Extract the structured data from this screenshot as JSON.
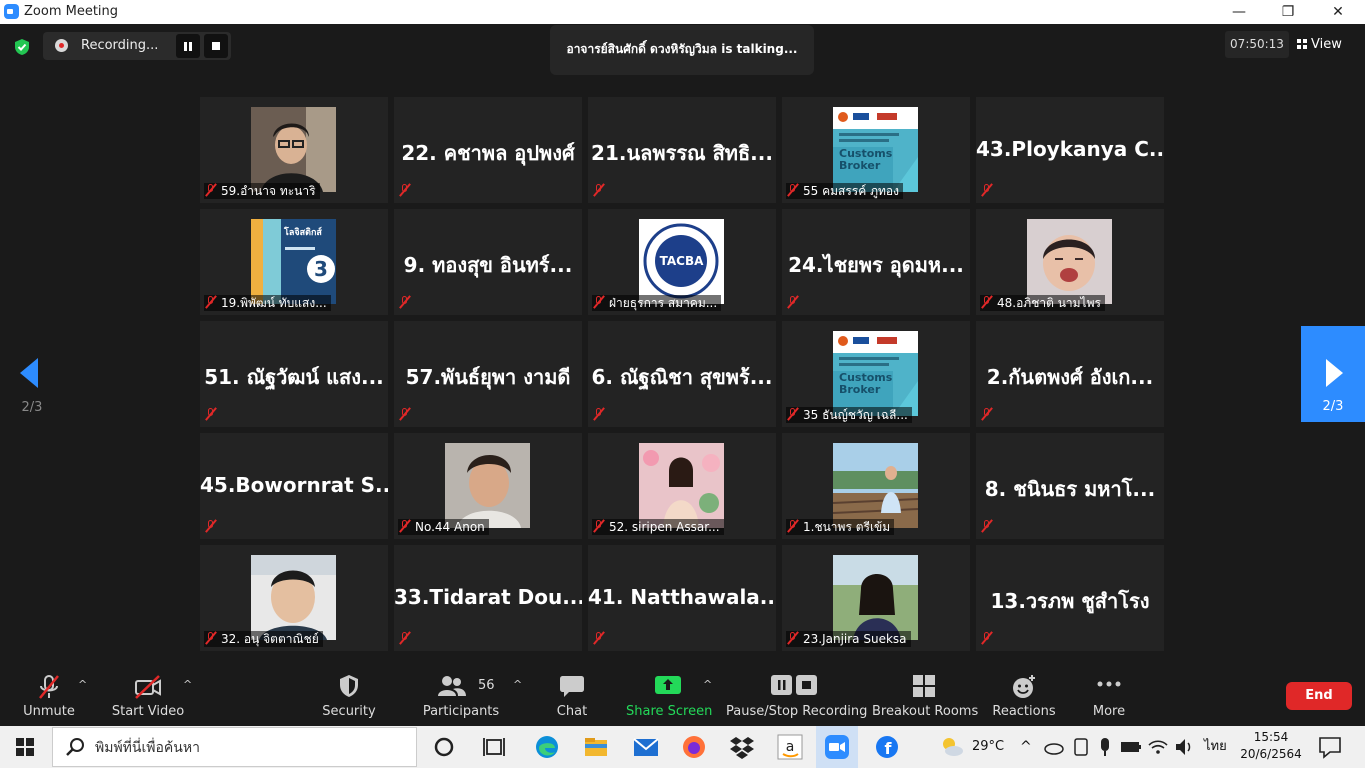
{
  "window": {
    "title": "Zoom Meeting",
    "minimize": "—",
    "restore": "❐",
    "close": "✕"
  },
  "recording": {
    "label": "Recording..."
  },
  "talking": {
    "text": "อาจารย์สินศักดิ์  ดวงหิรัญวิมล is talking..."
  },
  "meeting_timer": "07:50:13",
  "view_label": "View",
  "pager": {
    "left_page": "2/3",
    "right_page": "2/3"
  },
  "participants": [
    {
      "big": "",
      "label": "59.อำนาจ ทะนาริ",
      "photo": "man-glasses"
    },
    {
      "big": "22. คชาพล อุปพงศ์",
      "label": ""
    },
    {
      "big": "21.นลพรรณ สิทธิ...",
      "label": ""
    },
    {
      "big": "",
      "label": "55 คมสรรค์ ภูทอง",
      "photo": "customs-broker",
      "photo_text1": "Customs",
      "photo_text2": "Broker"
    },
    {
      "big": "43.Ploykanya  C...",
      "label": ""
    },
    {
      "big": "",
      "label": "19.พิพัฒน์ ทับแสง...",
      "photo": "logistics-book",
      "photo_text1": "โลจิสติกส์",
      "photo_text2": "3"
    },
    {
      "big": "9. ทองสุข อินทร์...",
      "label": ""
    },
    {
      "big": "",
      "label": "ฝ่ายธุรการ สมาคม...",
      "photo": "tacba-logo",
      "photo_text1": "TACBA"
    },
    {
      "big": "24.ไชยพร อุดมห...",
      "label": ""
    },
    {
      "big": "",
      "label": "48.อภิชาติ นามไพร",
      "photo": "baby"
    },
    {
      "big": "51. ณัฐวัฒน์ แสง...",
      "label": ""
    },
    {
      "big": "57.พันธ์ยุพา งามดี",
      "label": ""
    },
    {
      "big": "6. ณัฐณิชา สุขพร้...",
      "label": ""
    },
    {
      "big": "",
      "label": "35 ธันญ์ชวัญ เฉลี...",
      "photo": "customs-broker",
      "photo_text1": "Customs",
      "photo_text2": "Broker"
    },
    {
      "big": "2.กันตพงศ์ อังเก...",
      "label": ""
    },
    {
      "big": "45.Bowornrat  S...",
      "label": ""
    },
    {
      "big": "",
      "label": "No.44 Anon",
      "photo": "young-man"
    },
    {
      "big": "",
      "label": "52. siripen Assar...",
      "photo": "woman-flowers"
    },
    {
      "big": "",
      "label": "1.ชนาพร  ตรีเข้ม",
      "photo": "woman-bridge"
    },
    {
      "big": "8. ชนินธร มหาโ...",
      "label": ""
    },
    {
      "big": "",
      "label": "32. อนุ จิตตาณิชย์",
      "photo": "man-office"
    },
    {
      "big": "33.Tidarat  Dou...",
      "label": ""
    },
    {
      "big": "41.  Natthawala...",
      "label": ""
    },
    {
      "big": "",
      "label": "23.Janjira Sueksa",
      "photo": "woman-outdoor"
    },
    {
      "big": "13.วรภพ ชูสำโรง",
      "label": ""
    }
  ],
  "toolbar": {
    "unmute": "Unmute",
    "start_video": "Start Video",
    "security": "Security",
    "participants": "Participants",
    "participant_count": "56",
    "chat": "Chat",
    "share_screen": "Share Screen",
    "pause_stop_recording": "Pause/Stop Recording",
    "breakout_rooms": "Breakout Rooms",
    "reactions": "Reactions",
    "more": "More",
    "end": "End",
    "caret": "^"
  },
  "taskbar": {
    "search_placeholder": "พิมพ์ที่นี่เพื่อค้นหา",
    "weather": "29°C",
    "language": "ไทย",
    "time": "15:54",
    "date": "20/6/2564"
  },
  "colors": {
    "accent": "#2d8cff",
    "end_red": "#e02828",
    "share_green": "#23d959",
    "tile_bg": "#232323"
  }
}
